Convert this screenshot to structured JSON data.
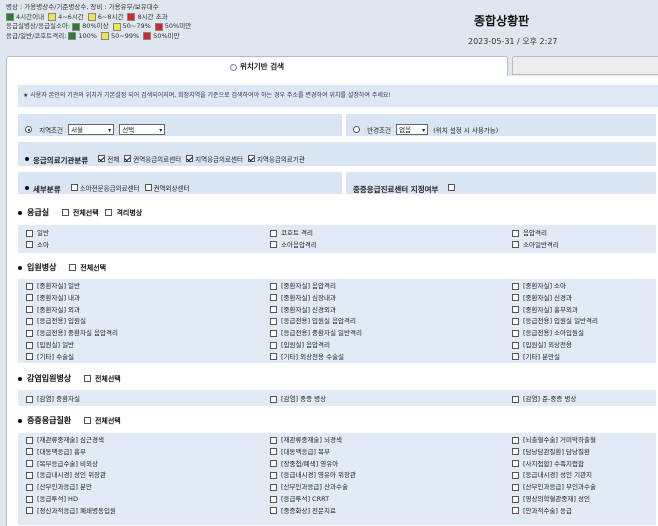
{
  "header": {
    "legend_rows": [
      {
        "label": "병상 : 가용병상수/기준병상수, 장비 : 가용유무/보유대수",
        "items": []
      },
      {
        "label": "",
        "items": [
          {
            "color": "#2e7d32",
            "text": "4시간이내"
          },
          {
            "color": "#f3e44a",
            "text": "4~6시간"
          },
          {
            "color": "#f3e44a",
            "text": "6~8시간"
          },
          {
            "color": "#d62828",
            "text": "8시간 초과"
          }
        ]
      },
      {
        "label": "응급실병상/응급실소아:",
        "items": [
          {
            "color": "#2e7d32",
            "text": "80%이상"
          },
          {
            "color": "#f3e44a",
            "text": "50~79%"
          },
          {
            "color": "#d62828",
            "text": "50%미만"
          }
        ]
      },
      {
        "label": "응급/일반/코호트격리:",
        "items": [
          {
            "color": "#2e7d32",
            "text": "100%"
          },
          {
            "color": "#f3e44a",
            "text": "50~99%"
          },
          {
            "color": "#d62828",
            "text": "50%미만"
          }
        ]
      }
    ],
    "title": "종합상황판",
    "datetime": "2023-05-31 / 오후 2:27"
  },
  "tabs": [
    {
      "label": "위치기반 검색",
      "active": true
    },
    {
      "label": "",
      "active": false
    }
  ],
  "notice": "★ 사용자 본인의 기관의 위치가 기본설정 되어 검색되어지며, 희정지역을 기준으로 검색하여야 하는 경우 주소를 변경하여 위치를 설정하여 주세요!",
  "region": {
    "label": "지역조건",
    "province": "서울",
    "district": "선택"
  },
  "radius": {
    "label": "반경조건",
    "value": "없음",
    "hint": "(위치 설정 시 사용가능)"
  },
  "emergency_class": {
    "label": "응급의료기관분류",
    "options": [
      {
        "label": "전체",
        "checked": true
      },
      {
        "label": "권역응급의료센터",
        "checked": true
      },
      {
        "label": "지역응급의료센터",
        "checked": true
      },
      {
        "label": "지역응급의료기관",
        "checked": true
      }
    ]
  },
  "subclass": {
    "label": "세부분류",
    "options": [
      {
        "label": "소아전문응급의료센터",
        "checked": false
      },
      {
        "label": "권역외상센터",
        "checked": false
      }
    ]
  },
  "severe_center": {
    "label": "중증응급진료센터 지정여부",
    "checked": false
  },
  "sections": {
    "er": {
      "title": "응급실",
      "select_all": "전체선택",
      "extra": "격리병상",
      "items": [
        "일반",
        "코호트 격리",
        "음압격리",
        "소아",
        "소아음압격리",
        "소아일반격리"
      ]
    },
    "ward": {
      "title": "입원병상",
      "select_all": "전체선택",
      "items": [
        "[중환자실] 일반",
        "[중환자실] 음압격리",
        "[중환자실] 소아",
        "[중환자실] 내과",
        "[중환자실] 심장내과",
        "[중환자실] 신경과",
        "[중환자실] 외과",
        "[중환자실] 신경외과",
        "[중환자실] 흉부외과",
        "[응급전용] 입원실",
        "[응급전용] 입원실 음압격리",
        "[응급전용] 입원실 일반격리",
        "[응급전용] 중환자실 음압격리",
        "[응급전용] 중환자실 일반격리",
        "[응급전용] 소아입원실",
        "[입원실] 일반",
        "[입원실] 음압격리",
        "[입원실] 외상전용",
        "[기타] 수술실",
        "[기타] 외상전용 수술실",
        "[기타] 분만실"
      ]
    },
    "infection": {
      "title": "감염입원병상",
      "select_all": "전체선택",
      "items": [
        "[감염] 중환자실",
        "[감염] 중증 병상",
        "[감염] 준-중증 병상"
      ]
    },
    "severe": {
      "title": "중증응급질환",
      "select_all": "전체선택",
      "items": [
        "[재관류중재술] 심근경색",
        "[재관류중재술] 뇌경색",
        "[뇌출혈수술] 거미막하출혈",
        "[대동맥응급] 흉부",
        "[대동맥응급] 복부",
        "[담낭담관질환] 담낭질환",
        "[복부응급수술] 비외상",
        "[장중첩/폐색] 영유아",
        "[사지접합] 수족지접합",
        "[응급내시경] 성인 위장관",
        "[응급내시경] 영유아 위장관",
        "[응급내시경] 성인 기관지",
        "[산부인과응급] 분만",
        "[산부인과응급] 산과수술",
        "[산부인과응급] 부인과수술",
        "[응급투석] HD",
        "[응급투석] CRRT",
        "[영상의학혈관중재] 성인",
        "[정신과적응급] 폐쇄병동입원",
        "[중증화상] 전문치료",
        "[안과적수술] 응급"
      ]
    }
  }
}
